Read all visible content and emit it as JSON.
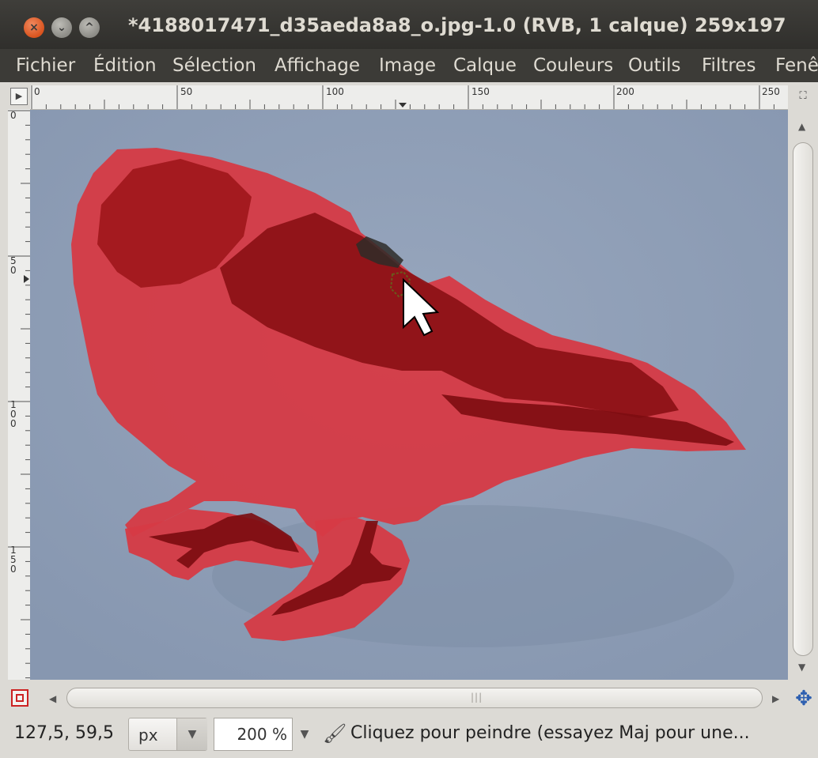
{
  "window": {
    "title": "*4188017471_d35aeda8a8_o.jpg-1.0 (RVB, 1 calque) 259x197",
    "buttons": {
      "close": "×",
      "minimize": "⌄",
      "maximize": "^"
    }
  },
  "menubar": {
    "items": [
      "Fichier",
      "Édition",
      "Sélection",
      "Affichage",
      "Image",
      "Calque",
      "Couleurs",
      "Outils",
      "Filtres",
      "Fenê"
    ]
  },
  "ruler": {
    "horizontal_labels": [
      "0",
      "50",
      "100",
      "150",
      "200",
      "250"
    ],
    "vertical_labels": [
      "0",
      "5\n0",
      "1\n0\n0",
      "1\n5\n0"
    ]
  },
  "scrollbar": {
    "grip": "|||"
  },
  "status": {
    "coordinates": "127,5, 59,5",
    "unit": "px",
    "zoom": "200 %",
    "message": "Cliquez pour peindre (essayez Maj pour une..."
  },
  "icons": {
    "ruler_menu": "triangle-right-icon",
    "zoom_toggle": "zoom-icon",
    "quick_mask": "quick-mask-icon",
    "navigate": "move-arrows-icon",
    "paint_tool": "paintbrush-icon"
  },
  "colors": {
    "titlebar": "#3c3b37",
    "canvas_background": "#8d9db6",
    "mask_red": "#d63a45",
    "bird_dark_red": "#8a0f14",
    "navigate_blue": "#2d5fb0"
  }
}
